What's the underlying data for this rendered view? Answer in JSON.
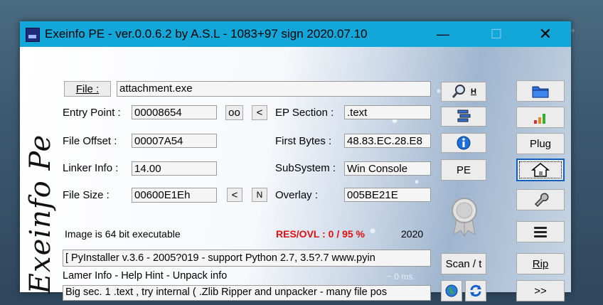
{
  "window": {
    "title": "Exeinfo PE - ver.0.0.6.2  by A.S.L -  1083+97 sign  2020.07.10",
    "min_glyph": "—",
    "max_glyph": "☐",
    "close_glyph": "✕"
  },
  "logo_text": "Exeinfo  Pe",
  "file": {
    "button_label": "File :",
    "value": "attachment.exe"
  },
  "fields": {
    "entry_point_label": "Entry Point :",
    "entry_point_value": "00008654",
    "oo_label": "oo",
    "lt_label": "<",
    "ep_section_label": "EP Section :",
    "ep_section_value": ".text",
    "file_offset_label": "File Offset :",
    "file_offset_value": "00007A54",
    "first_bytes_label": "First Bytes :",
    "first_bytes_value": "48.83.EC.28.E8",
    "linker_info_label": "Linker Info :",
    "linker_info_value": "14.00",
    "subsystem_label": "SubSystem :",
    "subsystem_value": "Win Console",
    "file_size_label": "File Size :",
    "file_size_value": "00600E1Eh",
    "size_lt_label": "<",
    "size_n_label": "N",
    "overlay_label": "Overlay :",
    "overlay_value": "005BE21E"
  },
  "status": {
    "image_bits": "Image is 64 bit executable",
    "res_ovl": "RES/OVL : 0 / 95 %",
    "year": "2020",
    "detection": "[ PyInstaller v.3.6  - 2005?019 - support Python 2.7, 3.5?.7 www.pyin",
    "lamer_info": "Lamer Info - Help Hint - Unpack info",
    "time": "~ 0 ms.",
    "hint": "Big sec. 1 .text , try internal ( .Zlib Ripper and unpacker - many file pos"
  },
  "buttons": {
    "search_h_label": "H",
    "pe_label": "PE",
    "scan_label": "Scan / t",
    "plug_label": "Plug",
    "rip_label": "Rip",
    "more_label": ">>"
  },
  "colors": {
    "titlebar": "#13a6d8",
    "res_ovl": "#e01010"
  }
}
